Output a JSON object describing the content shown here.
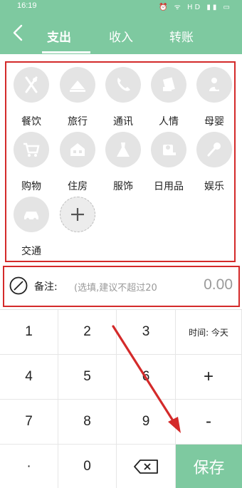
{
  "status_bar": {
    "time": "16:19",
    "icons": "⏰ ᯤ HD ▮▮ ▭"
  },
  "header": {
    "back_icon": "chevron-left-icon",
    "tabs": [
      {
        "label": "支出",
        "active": true
      },
      {
        "label": "收入",
        "active": false
      },
      {
        "label": "转账",
        "active": false
      }
    ]
  },
  "categories": [
    {
      "label": "餐饮",
      "icon": "fork-knife-icon"
    },
    {
      "label": "旅行",
      "icon": "tent-icon"
    },
    {
      "label": "通讯",
      "icon": "phone-icon"
    },
    {
      "label": "人情",
      "icon": "gift-icon"
    },
    {
      "label": "母婴",
      "icon": "baby-icon"
    },
    {
      "label": "购物",
      "icon": "cart-icon"
    },
    {
      "label": "住房",
      "icon": "house-icon"
    },
    {
      "label": "服饰",
      "icon": "dress-icon"
    },
    {
      "label": "日用品",
      "icon": "tissue-icon"
    },
    {
      "label": "娱乐",
      "icon": "microphone-icon"
    },
    {
      "label": "交通",
      "icon": "car-icon"
    },
    {
      "label": "",
      "icon": "plus-icon"
    }
  ],
  "note": {
    "label": "备注:",
    "placeholder": "(选填,建议不超过20",
    "amount": "0.00"
  },
  "keypad": {
    "k1": "1",
    "k2": "2",
    "k3": "3",
    "time": "时间: 今天",
    "k4": "4",
    "k5": "5",
    "k6": "6",
    "plus": "+",
    "k7": "7",
    "k8": "8",
    "k9": "9",
    "minus": "-",
    "dot": "·",
    "k0": "0",
    "save": "保存"
  },
  "colors": {
    "primary": "#7ec9a0",
    "annotation": "#d42a2a"
  }
}
